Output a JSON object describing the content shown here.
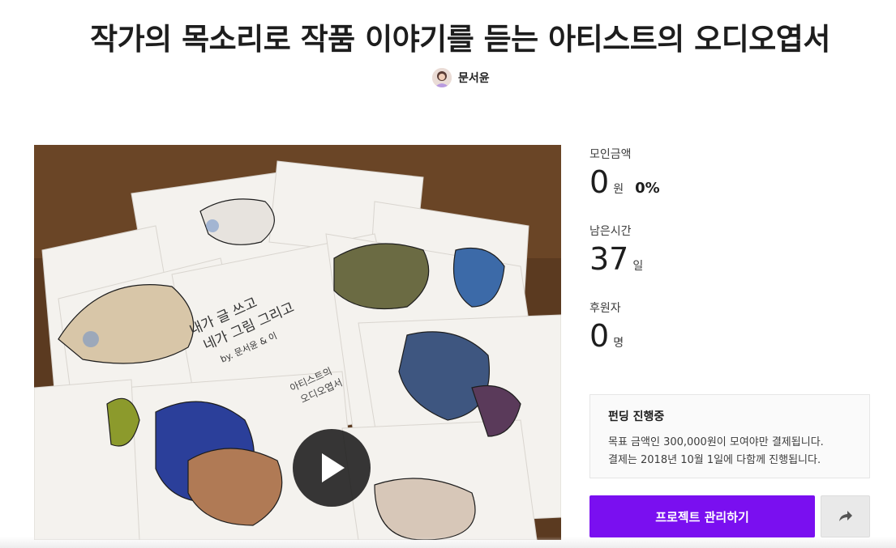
{
  "project": {
    "title": "작가의 목소리로 작품 이야기를 듣는 아티스트의 오디오엽서",
    "creator_name": "문서윤"
  },
  "video": {
    "card_text_line1": "내가 글 쓰고",
    "card_text_line2": "네가 그림 그리고",
    "card_text_line3": "by. 문서윤 & 이",
    "card_text_line4": "아티스트의",
    "card_text_line5": "오디오엽서"
  },
  "stats": {
    "amount_label": "모인금액",
    "amount_value": "0",
    "amount_unit": "원",
    "amount_percent": "0%",
    "time_label": "남은시간",
    "time_value": "37",
    "time_unit": "일",
    "backers_label": "후원자",
    "backers_value": "0",
    "backers_unit": "명"
  },
  "notice": {
    "title": "펀딩 진행중",
    "line1": "목표 금액인 300,000원이 모여야만 결제됩니다.",
    "line2": "결제는 2018년 10월 1일에 다함께 진행됩니다."
  },
  "actions": {
    "manage_label": "프로젝트 관리하기"
  },
  "colors": {
    "accent": "#7a0ff0"
  },
  "icons": {
    "play": "play-icon",
    "share": "share-icon"
  }
}
